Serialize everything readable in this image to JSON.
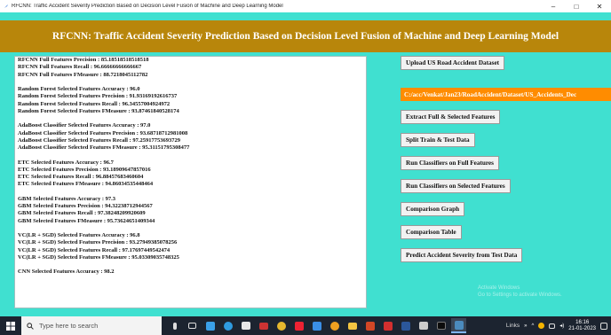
{
  "window": {
    "title": "RFCNN: Traffic Accident Severity Prediction Based on Decision Level Fusion of Machine and Deep Learning Model",
    "minimize_glyph": "–",
    "maximize_glyph": "□",
    "close_glyph": "✕"
  },
  "app": {
    "header_title": "RFCNN: Traffic Accident Severity Prediction Based on Decision Level Fusion of Machine and Deep Learning Model",
    "colors": {
      "background": "#40E0D0",
      "header": "#B8860B",
      "path_field": "#FF8C00"
    }
  },
  "output_lines": [
    "RFCNN Full Features Precision : 85.18518518518518",
    "RFCNN Full Features Recall  : 96.66666666666667",
    "RFCNN Full Features FMeasure  : 88.7218045112782",
    "",
    "Random Forest Selected Features Accuracy  : 96.0",
    "Random Forest Selected Features Precision : 91.93169192616737",
    "Random Forest Selected Features Recall  : 96.3455700492497­2",
    "Random Forest Selected Features FMeasure  : 93.87461840528174",
    "",
    "AdaBoost Classifier Selected Features Accuracy  : 97.0",
    "AdaBoost Classifier Selected Features Precision : 93.68718712981008",
    "AdaBoost Classifier Selected Features Recall  : 97.25917753693729",
    "AdaBoost Classifier Selected Features FMeasure  : 95.31151795308477",
    "",
    "ETC Selected Features Accuracy  : 96.7",
    "ETC Selected Features Precision : 93.18909647857016",
    "ETC Selected Features Recall  : 96.88457683460604",
    "ETC Selected Features FMeasure  : 94.86034535448464",
    "",
    "GBM Selected Features Accuracy  : 97.3",
    "GBM Selected Features Precision : 94.32238712944567",
    "GBM Selected Features Recall  : 97.38248209920609",
    "GBM Selected Features FMeasure  : 95.73624651409344",
    "",
    "VC(LR + SGD) Selected Features Accuracy  : 96.8",
    "VC(LR + SGD) Selected Features Precision : 93.27949385078256",
    "VC(LR + SGD) Selected Features Recall  : 97.17697449542474",
    "VC(LR + SGD) Selected Features FMeasure  : 95.03309035748325",
    "",
    "CNN Selected Features Accuracy  : 98.2"
  ],
  "buttons": {
    "upload": "Upload US Road Accident Dataset",
    "dataset_path": "C:/acc/Venkat/Jan23/RoadAccident/Dataset/US_Accidents_Dec",
    "extract": "Extract Full & Selected Features",
    "split": "Split Train & Test Data",
    "run_full": "Run Classifiers on Full Features",
    "run_selected": "Run Classifiers on Selected Features",
    "comparison_graph": "Comparison Graph",
    "comparison_table": "Comparison Table",
    "predict": "Predict Accident Severity from Test Data"
  },
  "watermark": {
    "line1": "Activate Windows",
    "line2": "Go to Settings to activate Windows."
  },
  "taskbar": {
    "search_placeholder": "Type here to search",
    "links_label": "Links",
    "time": "16:16",
    "date": "21-01-2023"
  }
}
